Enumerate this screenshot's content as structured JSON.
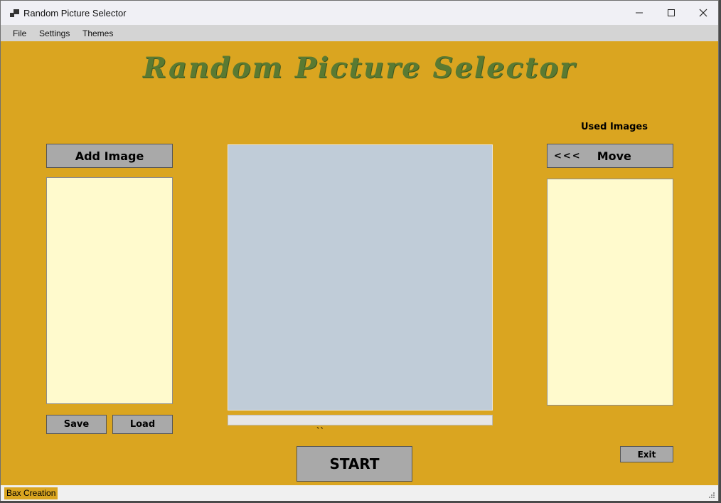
{
  "window": {
    "title": "Random Picture Selector",
    "minimize_icon": "minimize-icon",
    "maximize_icon": "maximize-icon",
    "close_icon": "close-icon"
  },
  "menu": {
    "file": "File",
    "settings": "Settings",
    "themes": "Themes"
  },
  "main": {
    "heading": "Random Picture Selector",
    "add_image_label": "Add Image",
    "save_label": "Save",
    "load_label": "Load",
    "used_images_label": "Used Images",
    "move_arrows": "<<<",
    "move_label": "Move",
    "start_label": "START",
    "exit_label": "Exit",
    "tick_mark": "``"
  },
  "status": {
    "text": "Bax Creation"
  },
  "colors": {
    "background": "#daa520",
    "heading": "#5a7a32",
    "button": "#a9a9a9",
    "list": "#fffacd",
    "picture": "#c0ccd8"
  }
}
